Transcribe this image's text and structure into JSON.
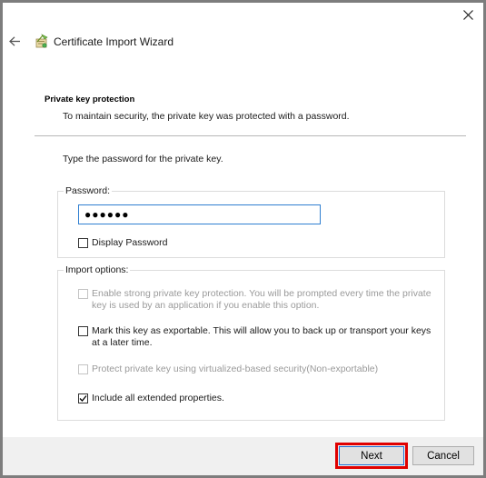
{
  "window": {
    "title": "Certificate Import Wizard"
  },
  "page": {
    "section_title": "Private key protection",
    "section_description": "To maintain security, the private key was protected with a password.",
    "instruction": "Type the password for the private key."
  },
  "password_group": {
    "label": "Password:",
    "value": "●●●●●●",
    "display_password_label": "Display Password",
    "display_password_checked": false
  },
  "import_options": {
    "label": "Import options:",
    "options": [
      {
        "label": "Enable strong private key protection. You will be prompted every time the private key is used by an application if you enable this option.",
        "checked": false,
        "enabled": false
      },
      {
        "label": "Mark this key as exportable. This will allow you to back up or transport your keys at a later time.",
        "checked": false,
        "enabled": true
      },
      {
        "label": "Protect private key using virtualized-based security(Non-exportable)",
        "checked": false,
        "enabled": false
      },
      {
        "label": "Include all extended properties.",
        "checked": true,
        "enabled": true
      }
    ]
  },
  "footer": {
    "next_label": "Next",
    "cancel_label": "Cancel"
  },
  "icons": {
    "close": "close-icon",
    "back": "back-arrow-icon",
    "wizard": "certificate-wizard-icon"
  },
  "colors": {
    "highlight": "#e00000",
    "focus_border": "#2f7fd1"
  }
}
